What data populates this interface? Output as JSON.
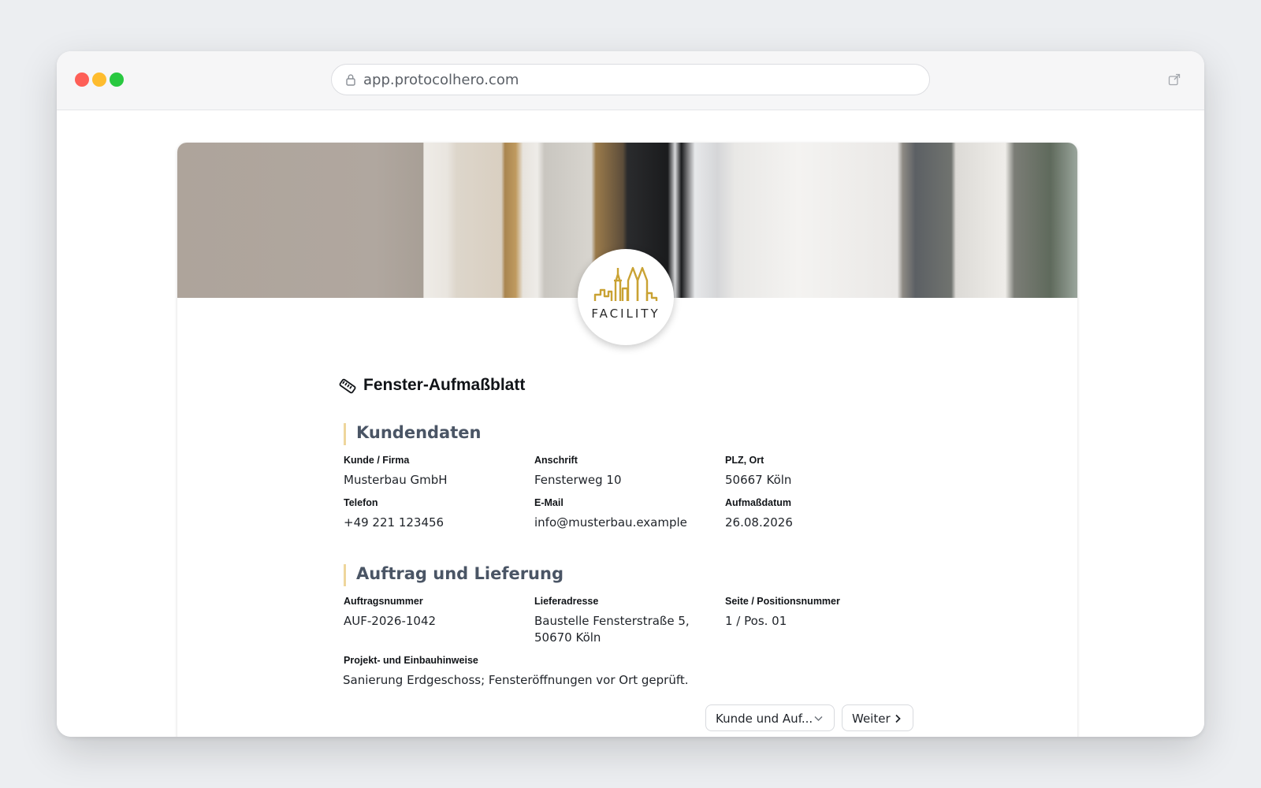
{
  "browser": {
    "url": "app.protocolhero.com",
    "icons": [
      "lock-icon",
      "external-link-icon"
    ]
  },
  "brand": {
    "logo_text": "FACILITY",
    "accent_color": "#c9a233"
  },
  "form": {
    "title": "Fenster-Aufmaßblatt",
    "icon": "ruler-icon"
  },
  "sections": {
    "kundendaten": {
      "title": "Kundendaten",
      "fields": {
        "kunde": {
          "label": "Kunde / Firma",
          "value": "Musterbau GmbH"
        },
        "anschrift": {
          "label": "Anschrift",
          "value": "Fensterweg 10"
        },
        "plz_ort": {
          "label": "PLZ, Ort",
          "value": "50667 Köln"
        },
        "telefon": {
          "label": "Telefon",
          "value": "+49 221 123456"
        },
        "email": {
          "label": "E-Mail",
          "value": "info@musterbau.example"
        },
        "datum": {
          "label": "Aufmaßdatum",
          "value": "26.08.2026"
        }
      }
    },
    "auftrag": {
      "title": "Auftrag und Lieferung",
      "fields": {
        "auftragsnummer": {
          "label": "Auftragsnummer",
          "value": "AUF-2026-1042"
        },
        "lieferadresse": {
          "label": "Lieferadresse",
          "value": "Baustelle Fensterstraße 5, 50670 Köln"
        },
        "seite": {
          "label": "Seite / Positionsnummer",
          "value": "1 / Pos. 01"
        },
        "hinweise": {
          "label": "Projekt- und Einbauhinweise",
          "value": "Sanierung Erdgeschoss; Fensteröffnungen vor Ort geprüft."
        }
      }
    }
  },
  "navigation": {
    "section_select": "Kunde und Auf...",
    "next_label": "Weiter"
  }
}
